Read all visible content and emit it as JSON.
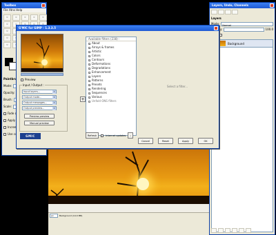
{
  "toolbox": {
    "title": "Toolbox",
    "menu": "File  Xtns  Help",
    "tool_icons": [
      "rect-select-icon",
      "ellipse-select-icon",
      "lasso-icon",
      "fuzzy-select-icon",
      "color-select-icon",
      "scissors-icon",
      "paths-icon",
      "color-picker-icon",
      "zoom-icon",
      "measure-icon",
      "move-icon",
      "align-icon",
      "crop-icon",
      "rotate-icon",
      "scale-icon",
      "shear-icon",
      "perspective-icon",
      "flip-icon",
      "text-icon",
      "bucket-fill-icon",
      "blend-icon",
      "pencil-icon",
      "paintbrush-icon",
      "eraser-icon",
      "airbrush-icon"
    ],
    "options_title": "Paintbrush",
    "mode_label": "Mode:",
    "opacity_label": "Opacity:",
    "brush_label": "Brush:",
    "scale_label": "Scale:",
    "opt1": "Fade out",
    "opt2": "Apply Jitter",
    "opt3": "Incremental",
    "opt4": "Use color from gradient"
  },
  "layers": {
    "title": "Layers, Undo, Channels",
    "layers_tab": "Layers",
    "mode_label": "Mode:",
    "mode_value": "Normal",
    "opacity_label": "Opacity:",
    "opacity_value": "100.0",
    "lock_label": "Lock:",
    "layer_name": "Background"
  },
  "image": {
    "unit": "px",
    "status": "Background (14.0 MB)"
  },
  "gmic": {
    "title": "G'MIC for GIMP - 1.3.3.5",
    "preview_checkbox": "Preview",
    "io_title": "Input / Output :",
    "input_layers": "Input layers...",
    "output_mode": "Output mode...",
    "output_messages": "Output messages...",
    "output_preview": "Output preview...",
    "btn_preview": "Preview preview",
    "btn_manual": "Manual preview",
    "logo": "GMIC",
    "list_header": "Available filters (238) :",
    "categories": [
      "About",
      "Arrays & frames",
      "Artistic",
      "Colors",
      "Contours",
      "Deformations",
      "Degradations",
      "Enhancement",
      "Layers",
      "Patterns",
      "Presets",
      "Rendering",
      "Sequences",
      "Various",
      "Unfold ONS filters"
    ],
    "refresh": "Refresh",
    "internet_updates": "Internet updates",
    "select_filter": "Select a filter...",
    "buttons": {
      "cancel": "Cancel",
      "reset": "Reset",
      "apply": "Apply",
      "ok": "OK"
    }
  }
}
